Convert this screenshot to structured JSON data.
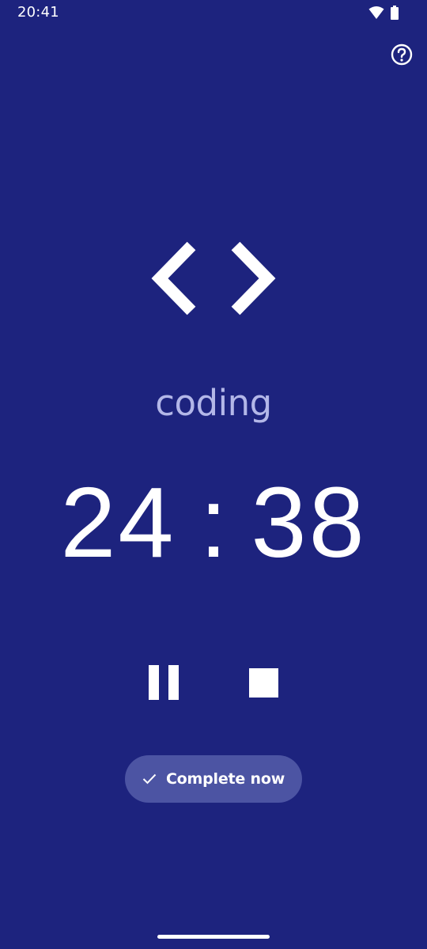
{
  "status_bar": {
    "time": "20:41",
    "icons": [
      "wifi-icon",
      "battery-icon"
    ]
  },
  "header": {
    "help_icon": "help-circle-icon"
  },
  "activity": {
    "icon": "code-brackets-icon",
    "label": "coding"
  },
  "timer": {
    "minutes": "24",
    "separator": ":",
    "seconds": "38"
  },
  "controls": {
    "pause_icon": "pause-icon",
    "stop_icon": "stop-icon"
  },
  "complete": {
    "icon": "check-icon",
    "label": "Complete now"
  },
  "colors": {
    "background": "#1d237e",
    "activity_label": "#b3b7e8",
    "complete_button": "#4c54a3",
    "foreground": "#ffffff"
  }
}
